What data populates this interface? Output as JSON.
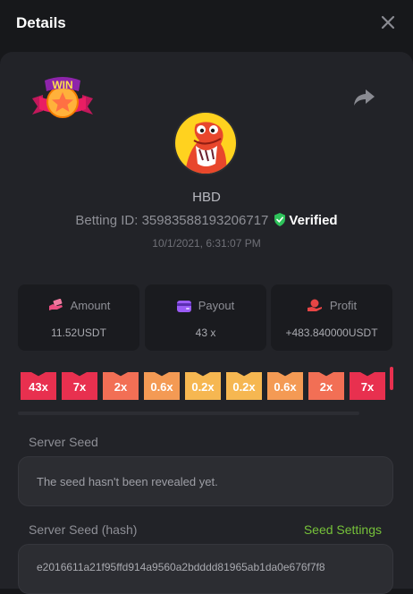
{
  "header": {
    "title": "Details"
  },
  "badge": {
    "text": "WIN"
  },
  "player": {
    "username": "HBD",
    "betting_id_label": "Betting ID: 35983588193206717",
    "verified_label": "Verified",
    "datetime": "10/1/2021, 6:31:07 PM"
  },
  "stats": [
    {
      "label": "Amount",
      "value": "11.52USDT",
      "icon": "cash-hand-icon",
      "icon_color": "#ec4f82"
    },
    {
      "label": "Payout",
      "value": "43 x",
      "icon": "card-icon",
      "icon_color": "#9b5cf6"
    },
    {
      "label": "Profit",
      "value": "+483.840000USDT",
      "icon": "coin-hand-icon",
      "icon_color": "#e84545"
    }
  ],
  "multipliers": [
    {
      "label": "43x",
      "color": "#e8304f"
    },
    {
      "label": "7x",
      "color": "#e8304f"
    },
    {
      "label": "2x",
      "color": "#f26f55"
    },
    {
      "label": "0.6x",
      "color": "#f49a54"
    },
    {
      "label": "0.2x",
      "color": "#f6b751"
    },
    {
      "label": "0.2x",
      "color": "#f6b751"
    },
    {
      "label": "0.6x",
      "color": "#f49a54"
    },
    {
      "label": "2x",
      "color": "#f26f55"
    },
    {
      "label": "7x",
      "color": "#e8304f"
    }
  ],
  "server_seed": {
    "label": "Server Seed",
    "value": "The seed hasn't been revealed yet."
  },
  "server_seed_hash": {
    "label": "Server Seed (hash)",
    "settings_link": "Seed Settings",
    "value": "e2016611a21f95ffd914a9560a2bdddd81965ab1da0e676f7f8"
  },
  "colors": {
    "accent_green": "#76c13a",
    "verified_green": "#2ec25a",
    "background": "#17181b",
    "panel": "#222328"
  }
}
